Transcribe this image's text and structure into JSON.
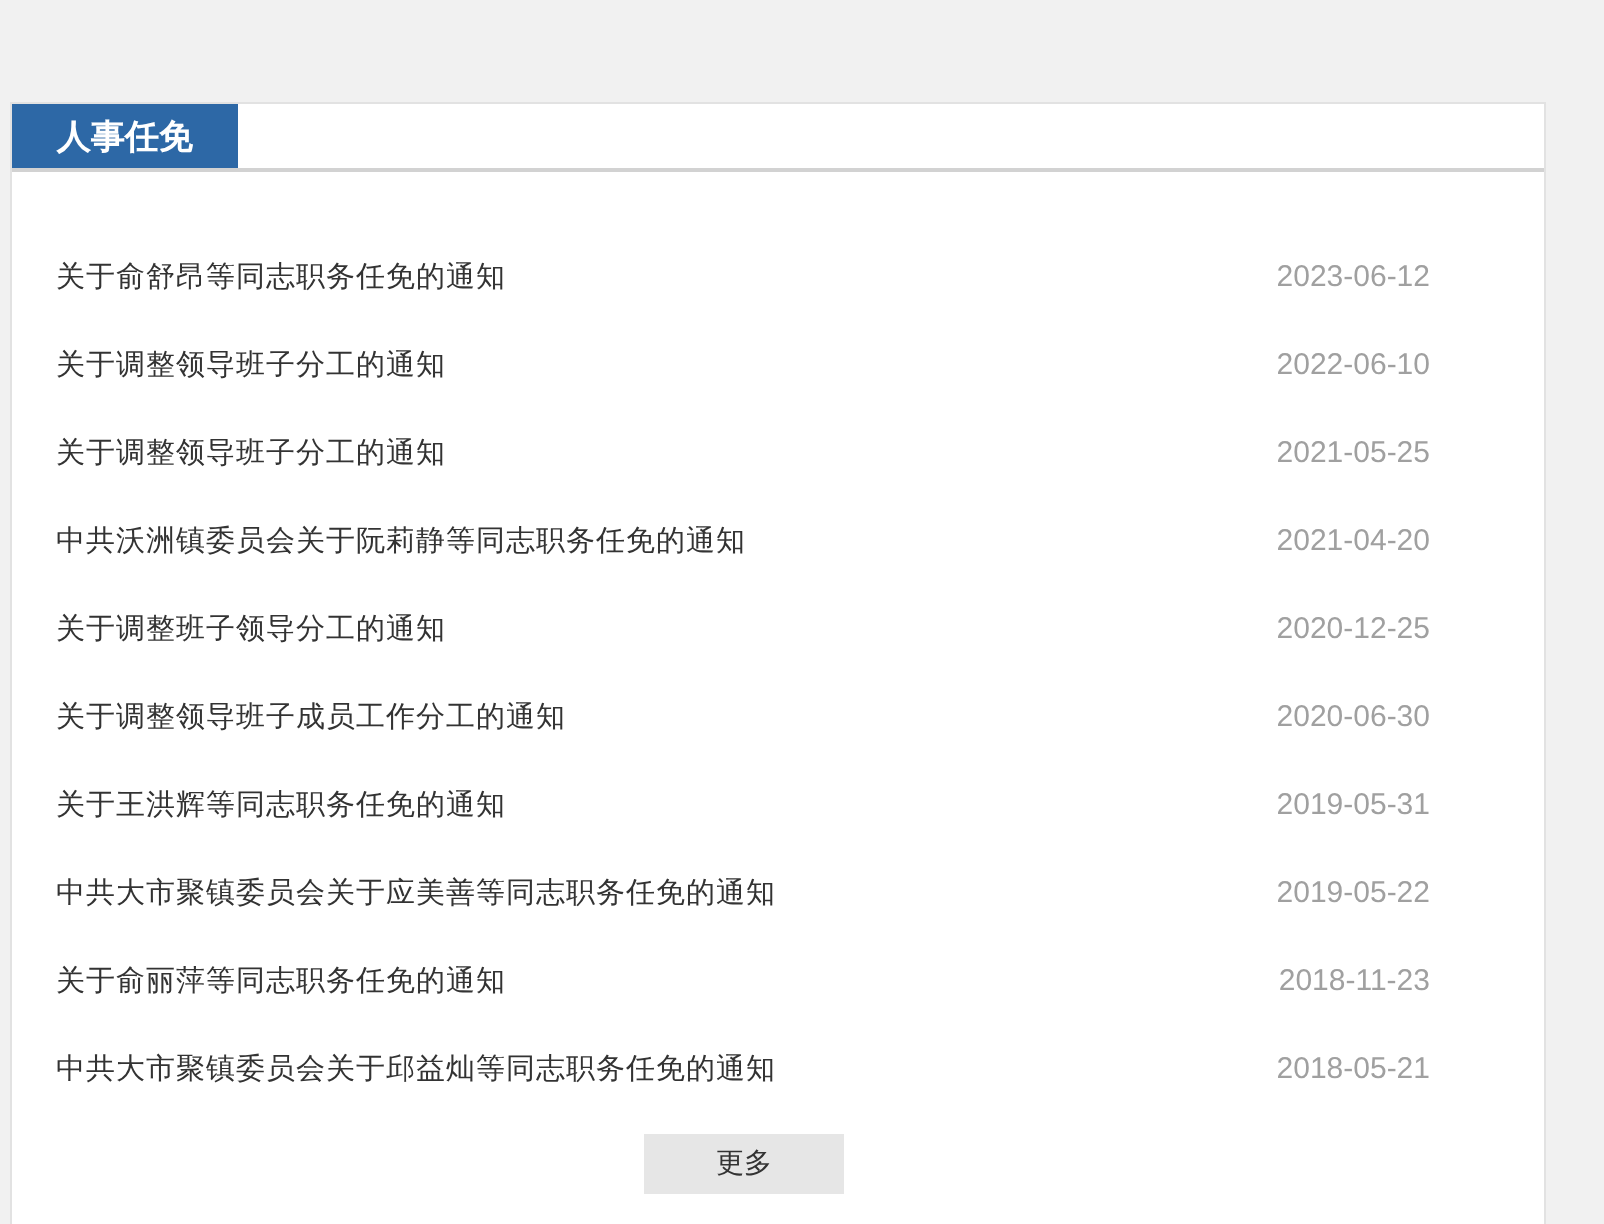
{
  "panel": {
    "title": "人事任免"
  },
  "items": [
    {
      "title": "关于俞舒昂等同志职务任免的通知",
      "date": "2023-06-12"
    },
    {
      "title": "关于调整领导班子分工的通知",
      "date": "2022-06-10"
    },
    {
      "title": "关于调整领导班子分工的通知",
      "date": "2021-05-25"
    },
    {
      "title": "中共沃洲镇委员会关于阮莉静等同志职务任免的通知",
      "date": "2021-04-20"
    },
    {
      "title": "关于调整班子领导分工的通知",
      "date": "2020-12-25"
    },
    {
      "title": "关于调整领导班子成员工作分工的通知",
      "date": "2020-06-30"
    },
    {
      "title": "关于王洪辉等同志职务任免的通知",
      "date": "2019-05-31"
    },
    {
      "title": "中共大市聚镇委员会关于应美善等同志职务任免的通知",
      "date": "2019-05-22"
    },
    {
      "title": "关于俞丽萍等同志职务任免的通知",
      "date": "2018-11-23"
    },
    {
      "title": "中共大市聚镇委员会关于邱益灿等同志职务任免的通知",
      "date": "2018-05-21"
    }
  ],
  "more_button": "更多"
}
